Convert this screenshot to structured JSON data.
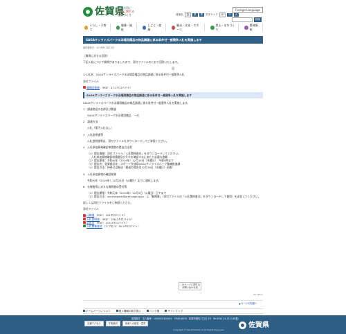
{
  "header": {
    "site_title": "佐賀県",
    "tagline1": "人を大切に",
    "tagline2": "世界に誇れる",
    "tagline3": "佐賀づくり",
    "foreign_language": "Foreign Language",
    "text_size_label": "文字サイズ",
    "size_small": "小",
    "size_medium": "中",
    "size_large": "大",
    "color_label": "背景色",
    "color_white": "白",
    "color_black": "黒",
    "color_blue": "青",
    "search_placeholder": "",
    "search_button": "検索"
  },
  "nav": {
    "items": [
      {
        "label": "くらし・子育て"
      },
      {
        "label": "健康・福祉"
      },
      {
        "label": "しごと・産業"
      },
      {
        "label": "観光・文化・スポーツ"
      },
      {
        "label": "県土・まちづくり"
      },
      {
        "label": "県政情報"
      }
    ]
  },
  "main": {
    "title": "SAGAサンライズパーク水泳場用備品の物品調達に係る条件付一般競争入札を実施します",
    "updated": "最終更新日：2019年12月10日",
    "p1": "［質問に対する回答］",
    "p2": "下記入札について質問がありましたので、添付ファイルのとおり回答いたします。",
    "center_ki": "記",
    "p3": "①入札名：SAGAサンライズパーク水泳場用備品の物品調達に係る条件付一般競争入札",
    "attach_label": "添付ファイル",
    "attach1": "質問回答書",
    "attach1_meta": "（PDF：47.1キロバイト）",
    "section_head": "SAGAサンライズパーク水泳場用備品の物品調達に係る条件付一般競争入札を実施します",
    "intro": "SAGAサンライズパーク水泳場用備品の物品調達に係る条件付一般競争入札を実施します。",
    "s1_title": "1　調達物品の名称及び数量",
    "s1_body": "SAGAサンライズパーク水泳場用備品　一式",
    "s2_title": "2　調達方法",
    "s2_body": "入札（電子入札なし）",
    "s3_title": "3　入札説明書等",
    "s3_body": "入札説明書等は、添付ファイルをダウンロードしてご参照ください。",
    "s4_title": "4　入札参加資格確認申請書の提出方法等",
    "s4_l1": "（1）提出書類：添付ファイル「入札関係書式」をダウンロードしてください。",
    "s4_l2": "入札参加資格確認申請書及びそれを確認するにあたり必要な書類",
    "s4_l3": "（2）提出期限：令和元年（2019年）12月19日（木曜日）　午後5時まで",
    "s4_l4": "（3）提出先：佐賀県文化・スポーツ交流局SAGAサンライズパーク整備推進課",
    "s4_l5": "（4）提出方法：持参又は郵送（郵送の場合は12月18日（水曜日）必着）",
    "s5_title": "5　入札参加資格の確認結果",
    "s5_body": "令和元年（2019年）12月24日（火曜日）までに通知します。",
    "s6_title": "6　仕様書等に対する質問書の受付等",
    "s6_l1": "（1）提出期限：令和元年（2019年）12月3日（火曜日）正午まで",
    "s6_l2": "（2）提出方法：sunrisepark@pref.saga.lg.jp　に「質問書」（添付ファイルの「入札関係書式」をダウンロードして使用）を送信してください。",
    "closing": "詳しくは添付ファイルをご参照ください。",
    "attach2_label": "添付ファイル",
    "files": [
      {
        "name": "仕様書",
        "meta": "（PDF：122キロバイト）"
      },
      {
        "name": "入札説明書",
        "meta": "（PDF：158.2キロバイト）"
      },
      {
        "name": "公告文",
        "meta": "（PDF：113.2キロバイト）"
      },
      {
        "name": "入札関係書式",
        "meta": "（エクセル：50.2キロバイト）"
      }
    ]
  },
  "feedback": {
    "line1": "このページに関する",
    "line2": "お問い合わせ先"
  },
  "small_copy": "ID:72617",
  "pagetop": "▲ページの先頭へ",
  "footer_nav": [
    {
      "label": "ホームページについて"
    },
    {
      "label": "個人情報の取り扱い"
    },
    {
      "label": "リンク集"
    },
    {
      "label": "サイトマップ"
    }
  ],
  "footer": {
    "address": "佐賀県庁　法人番号：1000020410004　〒840-8570　佐賀市城内1丁目1-59　Tel:0952-24-2111(代表)",
    "btn1": "交通アクセス",
    "btn2": "庁舎案内",
    "btn3": "県政への提言・意見",
    "logo_text": "佐賀県",
    "copyright": "Copyright © Saga Prefecture All Rights Reserved."
  }
}
